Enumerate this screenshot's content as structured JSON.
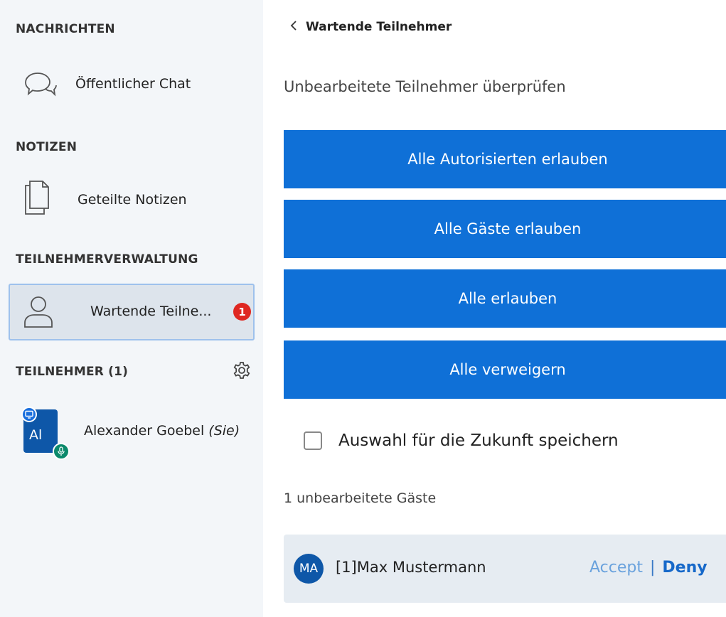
{
  "sidebar": {
    "messages_header": "NACHRICHTEN",
    "public_chat_label": "Öffentlicher Chat",
    "notes_header": "NOTIZEN",
    "shared_notes_label": "Geteilte Notizen",
    "participant_mgmt_header": "TEILNEHMERVERWALTUNG",
    "waiting_label": "Wartende Teilne...",
    "waiting_badge": "1",
    "participants_header": "TEILNEHMER (1)",
    "user": {
      "initials": "Al",
      "name": "Alexander Goebel",
      "you_suffix": "(Sie)"
    }
  },
  "main": {
    "back_title": "Wartende Teilnehmer",
    "subtitle": "Unbearbeitete Teilnehmer überprüfen",
    "buttons": [
      {
        "label": "Alle Autorisierten erlauben"
      },
      {
        "label": "Alle Gäste erlauben"
      },
      {
        "label": "Alle erlauben"
      },
      {
        "label": "Alle verweigern"
      }
    ],
    "remember_choice_label": "Auswahl für die Zukunft speichern",
    "remember_choice_checked": false,
    "guests_count_text": "1 unbearbeitete Gäste",
    "guests": [
      {
        "initials": "MA",
        "name": "[1]Max Mustermann",
        "accept_label": "Accept",
        "separator": "|",
        "deny_label": "Deny"
      }
    ]
  },
  "colors": {
    "primary_button": "#0f70d7",
    "sidebar_bg": "#f3f6f9",
    "badge_red": "#df2721",
    "avatar_blue": "#0e57a8",
    "mic_green": "#0c8a6c"
  }
}
